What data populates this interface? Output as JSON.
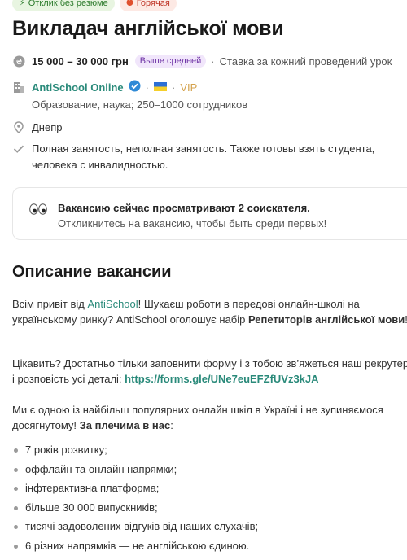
{
  "badges": {
    "resume": "Отклик без резюме",
    "hot": "Горячая",
    "resume_icon": "bolt-icon",
    "hot_icon": "flame-icon"
  },
  "title": "Викладач англійської мови",
  "salary": {
    "range": "15 000 – 30 000 грн",
    "level": "Выше средней",
    "note": "Ставка за кожний проведений урок",
    "icon": "money-icon"
  },
  "company": {
    "name": "AntiSchool Online",
    "verified_icon": "verified-check-icon",
    "flag_icon": "ukraine-flag-icon",
    "vip": "VIP",
    "details": "Образование, наука; 250–1000 сотрудников",
    "icon": "building-icon"
  },
  "location": {
    "city": "Днепр",
    "icon": "location-pin-icon"
  },
  "employment": {
    "text": "Полная занятость, неполная занятость. Также готовы взять студента, человека с инвалидностью.",
    "icon": "checkmark-icon"
  },
  "notice": {
    "title": "Вакансию сейчас просматривают 2 соискателя.",
    "subtitle": "Откликнитесь на вакансию, чтобы быть среди первых!",
    "icon": "eyes-icon"
  },
  "description": {
    "heading": "Описание вакансии",
    "p1_before": "Всім привіт від ",
    "p1_link": "AntiSchool",
    "p1_after": "! Шукаєш роботи в передові онлайн-школі на українському ринку? AntiSchool оголошує набір ",
    "p1_bold": "Репетиторів англійської мови",
    "p1_end": "!",
    "p2_before": "Цікавить? Достатньо тільки заповнити форму і з тобою зв’яжеться наш рекрутер і розповість усі деталі: ",
    "p2_link": "https://forms.gle/UNe7euEFZfUVz3kJA",
    "p3_before": "Ми є одною із найбільш популярних онлайн шкіл в Україні і не зупиняємося досягнутому! ",
    "p3_bold": "За плечима в нас",
    "p3_end": ":",
    "bullets": [
      "7 років розвитку;",
      "оффлайн та онлайн напрямки;",
      "інфтерактивна платформа;",
      "більше 30 000 випускників;",
      "тисячі задоволених відгуків від наших слухачів;",
      "6 різних напрямків — не англійською єдиною."
    ]
  }
}
